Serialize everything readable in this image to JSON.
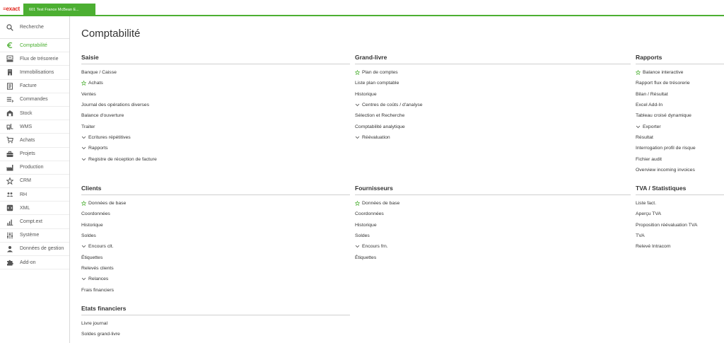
{
  "header": {
    "logo": "≡exact",
    "division_tab": "601 Test France McBean E..."
  },
  "sidebar": {
    "search_label": "Recherche",
    "items": [
      {
        "label": "Comptabilité",
        "icon": "euro-icon",
        "active": true
      },
      {
        "label": "Flux de trésorerie",
        "icon": "cash-register-icon"
      },
      {
        "label": "Immobilisations",
        "icon": "building-icon"
      },
      {
        "label": "Facture",
        "icon": "invoice-icon"
      },
      {
        "label": "Commandes",
        "icon": "orders-icon"
      },
      {
        "label": "Stock",
        "icon": "stock-icon"
      },
      {
        "label": "WMS",
        "icon": "forklift-icon"
      },
      {
        "label": "Achats",
        "icon": "cart-icon"
      },
      {
        "label": "Projets",
        "icon": "briefcase-icon"
      },
      {
        "label": "Production",
        "icon": "factory-icon"
      },
      {
        "label": "CRM",
        "icon": "crm-icon"
      },
      {
        "label": "RH",
        "icon": "people-icon"
      },
      {
        "label": "XML",
        "icon": "xml-icon"
      },
      {
        "label": "Compt.ext",
        "icon": "chart-icon"
      },
      {
        "label": "Système",
        "icon": "sliders-icon"
      },
      {
        "label": "Données de gestion",
        "icon": "user-icon"
      },
      {
        "label": "Add-on",
        "icon": "puzzle-icon"
      }
    ]
  },
  "page": {
    "title": "Comptabilité"
  },
  "sections": {
    "saisie": {
      "title": "Saisie",
      "items": [
        {
          "label": "Banque / Caisse",
          "marker": ""
        },
        {
          "label": "Achats",
          "marker": "star"
        },
        {
          "label": "Ventes",
          "marker": ""
        },
        {
          "label": "Journal des opérations diverses",
          "marker": ""
        },
        {
          "label": "Balance d'ouverture",
          "marker": ""
        },
        {
          "label": "Traiter",
          "marker": ""
        },
        {
          "label": "Ecritures répétitives",
          "marker": "chevron"
        },
        {
          "label": "Rapports",
          "marker": "chevron"
        },
        {
          "label": "Registre de réception de facture",
          "marker": "chevron"
        }
      ]
    },
    "grand_livre": {
      "title": "Grand-livre",
      "items": [
        {
          "label": "Plan de comptes",
          "marker": "star"
        },
        {
          "label": "Liste plan comptable",
          "marker": ""
        },
        {
          "label": "Historique",
          "marker": ""
        },
        {
          "label": "Centres de coûts / d'analyse",
          "marker": "chevron"
        },
        {
          "label": "Sélection et Recherche",
          "marker": ""
        },
        {
          "label": "Comptabilité analytique",
          "marker": ""
        },
        {
          "label": "Réévaluation",
          "marker": "chevron"
        }
      ]
    },
    "rapports": {
      "title": "Rapports",
      "items": [
        {
          "label": "Balance interactive",
          "marker": "star"
        },
        {
          "label": "Rapport flux de trésorerie",
          "marker": ""
        },
        {
          "label": "Bilan / Résultat",
          "marker": ""
        },
        {
          "label": "Excel Add-In",
          "marker": ""
        },
        {
          "label": "Tableau croisé dynamique",
          "marker": ""
        },
        {
          "label": "Exporter",
          "marker": "chevron"
        },
        {
          "label": "Résultat",
          "marker": ""
        },
        {
          "label": "Interrogation profil de risque",
          "marker": ""
        },
        {
          "label": "Fichier audit",
          "marker": ""
        },
        {
          "label": "Overview incoming invoices",
          "marker": ""
        }
      ]
    },
    "clients": {
      "title": "Clients",
      "items": [
        {
          "label": "Données de base",
          "marker": "star"
        },
        {
          "label": "Coordonnées",
          "marker": ""
        },
        {
          "label": "Historique",
          "marker": ""
        },
        {
          "label": "Soldes",
          "marker": ""
        },
        {
          "label": "Encours clt.",
          "marker": "chevron"
        },
        {
          "label": "Étiquettes",
          "marker": ""
        },
        {
          "label": "Relevés clients",
          "marker": ""
        },
        {
          "label": "Relances",
          "marker": "chevron"
        },
        {
          "label": "Frais financiers",
          "marker": ""
        }
      ]
    },
    "fournisseurs": {
      "title": "Fournisseurs",
      "items": [
        {
          "label": "Données de base",
          "marker": "star"
        },
        {
          "label": "Coordonnées",
          "marker": ""
        },
        {
          "label": "Historique",
          "marker": ""
        },
        {
          "label": "Soldes",
          "marker": ""
        },
        {
          "label": "Encours frn.",
          "marker": "chevron"
        },
        {
          "label": "Étiquettes",
          "marker": ""
        }
      ]
    },
    "tva": {
      "title": "TVA / Statistiques",
      "items": [
        {
          "label": "Liste fact.",
          "marker": ""
        },
        {
          "label": "Aperçu TVA",
          "marker": ""
        },
        {
          "label": "Proposition réévaluation TVA",
          "marker": ""
        },
        {
          "label": "TVA",
          "marker": ""
        },
        {
          "label": "Relevé Intracom",
          "marker": ""
        }
      ]
    },
    "etats": {
      "title": "Etats financiers",
      "items": [
        {
          "label": "Livre journal",
          "marker": ""
        },
        {
          "label": "Soldes grand-livre",
          "marker": ""
        }
      ]
    }
  },
  "colors": {
    "accent": "#4caf32",
    "brand": "#e1261c",
    "icon": "#555555"
  }
}
